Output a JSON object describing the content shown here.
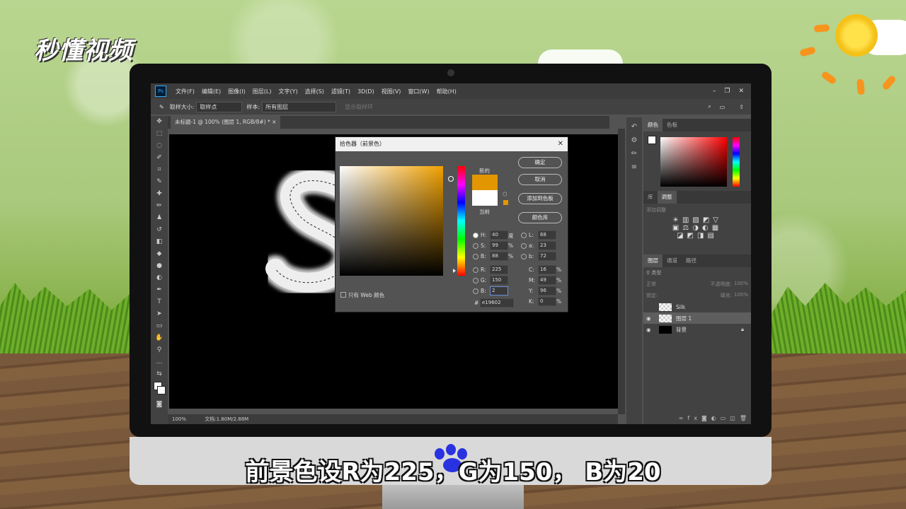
{
  "brand": {
    "logo_text": "秒懂视频"
  },
  "caption": "前景色设R为225，G为150， B为20",
  "photoshop": {
    "menu": [
      "文件(F)",
      "编辑(E)",
      "图像(I)",
      "图层(L)",
      "文字(Y)",
      "选择(S)",
      "滤镜(T)",
      "3D(D)",
      "视图(V)",
      "窗口(W)",
      "帮助(H)"
    ],
    "options": {
      "sample_size_label": "取样大小:",
      "sample_size_value": "取样点",
      "sample_label": "样本:",
      "sample_value": "所有图层",
      "show_ring": "显示取样环"
    },
    "document_tab": "未标题-1 @ 100% (图层 1, RGB/8#) *",
    "status": {
      "zoom": "100%",
      "doc": "文档:1.80M/2.88M"
    },
    "panels": {
      "color_tabs": [
        "颜色",
        "色板"
      ],
      "adjust_tabs": [
        "库",
        "调整"
      ],
      "adjust_hint": "添加调整",
      "layer_tabs": [
        "图层",
        "通道",
        "路径"
      ],
      "kind": "类型",
      "blend": "正常",
      "opacity_label": "不透明度:",
      "opacity_value": "100%",
      "lock_label": "锁定:",
      "fill_label": "填充:",
      "fill_value": "100%",
      "layers": [
        {
          "name": "Silk"
        },
        {
          "name": "图层 1"
        },
        {
          "name": "背景"
        }
      ]
    }
  },
  "dialog": {
    "title": "拾色器（前景色）",
    "new_label": "新的",
    "current_label": "当前",
    "buttons": {
      "ok": "确定",
      "cancel": "取消",
      "add_swatch": "添加到色板",
      "libraries": "颜色库"
    },
    "web_only": "只有 Web 颜色",
    "hsb": {
      "H": "40",
      "H_unit": "度",
      "S": "99",
      "S_unit": "%",
      "B": "88",
      "B_unit": "%"
    },
    "lab": {
      "L": "68",
      "a": "23",
      "b": "72"
    },
    "rgb": {
      "R": "225",
      "G": "150",
      "B": "2"
    },
    "cmyk": {
      "C": "16",
      "M": "49",
      "Y": "96",
      "K": "0",
      "unit": "%"
    },
    "hex_label": "#",
    "hex": "e19602",
    "new_color": "#e19602",
    "current_color": "#ffffff"
  }
}
